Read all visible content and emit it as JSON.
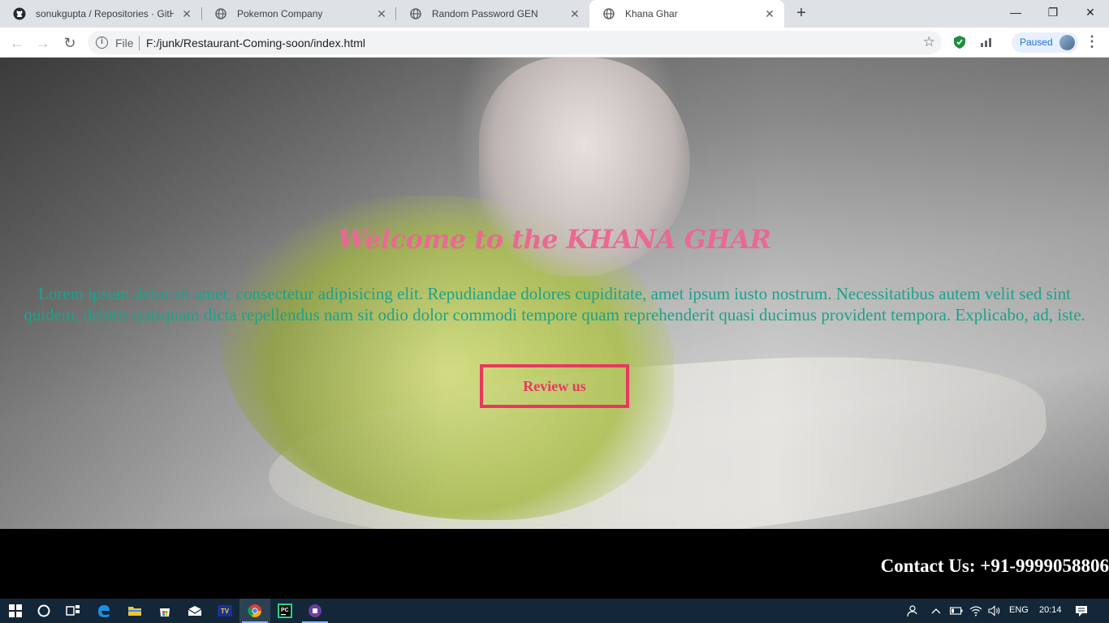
{
  "tabs": [
    {
      "title": "sonukgupta / Repositories · GitHu",
      "icon": "github-icon",
      "active": false
    },
    {
      "title": "Pokemon Company",
      "icon": "globe-icon",
      "active": false
    },
    {
      "title": "Random Password GEN",
      "icon": "globe-icon",
      "active": false
    },
    {
      "title": "Khana Ghar",
      "icon": "globe-icon",
      "active": true
    }
  ],
  "new_tab": "+",
  "window_controls": {
    "minimize": "—",
    "restore": "❐",
    "close": "✕"
  },
  "toolbar": {
    "back": "←",
    "forward": "→",
    "reload": "↻",
    "scheme": "File",
    "url": "F:/junk/Restaurant-Coming-soon/index.html",
    "star": "☆",
    "profile_status": "Paused",
    "menu": "⋮"
  },
  "page": {
    "heading": "Welcome to the KHANA GHAR",
    "paragraph": "Lorem ipsum dolor sit amet, consectetur adipisicing elit. Repudiandae dolores cupiditate, amet ipsum iusto nostrum. Necessitatibus autem velit sed sint quidem, debitis quisquam dicta repellendus nam sit odio dolor commodi tempore quam reprehenderit quasi ducimus provident tempora. Explicabo, ad, iste.",
    "review_button": "Review us",
    "contact": "Contact Us: +91-9999058806"
  },
  "colors": {
    "heading": "#e86a93",
    "paragraph": "#1fa287",
    "button": "#e8385f",
    "taskbar": "#132738"
  },
  "taskbar": {
    "language": "ENG",
    "time": "20:14",
    "apps": [
      "start-icon",
      "cortana-icon",
      "task-view-icon",
      "edge-icon",
      "file-explorer-icon",
      "store-icon",
      "mail-icon",
      "tv-icon",
      "chrome-icon",
      "pycharm-icon",
      "app-icon"
    ]
  }
}
